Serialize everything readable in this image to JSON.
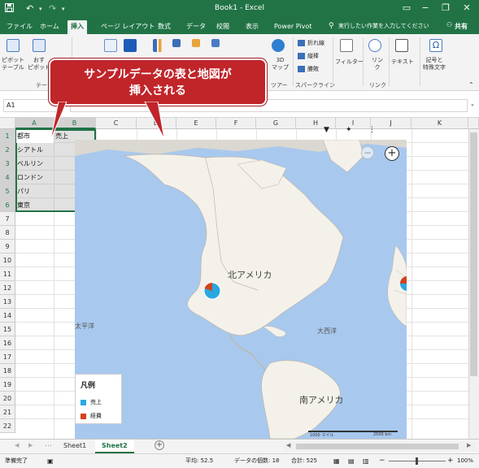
{
  "titlebar": {
    "title": "Book1 - Excel",
    "save_icon": "save-icon",
    "undo_icon": "undo-icon",
    "redo_icon": "redo-icon",
    "minimize": "−",
    "restore": "❐",
    "close": "✕",
    "ribbon_options": "▭"
  },
  "tabs": [
    "ファイル",
    "ホーム",
    "挿入",
    "ページ レイアウト",
    "数式",
    "データ",
    "校閲",
    "表示",
    "Power Pivot"
  ],
  "active_tab": "挿入",
  "tellme": "実行したい作業を入力してください",
  "share": "共有",
  "ribbon": {
    "pivot_label": "ピボット\nテーブル",
    "recommended_pivot_label": "おす\nピボット",
    "table_group": "テー",
    "map3d_label": "3D\nマップ",
    "tour_group": "ツアー",
    "sparklines": [
      "折れ線",
      "縦棒",
      "勝敗"
    ],
    "sparklines_group": "スパークライン",
    "filter_label": "フィルター",
    "link_label": "リン\nク",
    "link_group": "リンク",
    "text_label": "テキスト",
    "symbols_label": "記号と\n特殊文字"
  },
  "namebox": "A1",
  "columns": [
    "A",
    "B",
    "C",
    "D",
    "E",
    "F",
    "G",
    "H",
    "I",
    "J",
    "K"
  ],
  "rows": [
    "1",
    "2",
    "3",
    "4",
    "5",
    "6",
    "7",
    "8",
    "9",
    "10",
    "11",
    "12",
    "13",
    "14",
    "15",
    "16",
    "17",
    "18",
    "19",
    "20",
    "21",
    "22"
  ],
  "cells": {
    "A1": "都市",
    "B1": "売上",
    "A2": "シアトル",
    "A3": "ベルリン",
    "A4": "ロンドン",
    "A5": "パリ",
    "A6": "東京"
  },
  "callout": "サンプルデータの表と地図が\n挿入される",
  "map": {
    "labels": {
      "north_america": "北アメリカ",
      "south_america": "南アメリカ",
      "pacific": "太平洋",
      "atlantic": "大西洋"
    },
    "scale_left": "1000 マイル",
    "scale_right": "2500 km",
    "legend_title": "凡例",
    "legend": [
      {
        "label": "売上",
        "color": "#29a8e0"
      },
      {
        "label": "経費",
        "color": "#d0431f"
      }
    ]
  },
  "sheets": [
    "Sheet1",
    "Sheet2"
  ],
  "active_sheet": "Sheet2",
  "status": {
    "ready": "準備完了",
    "average": "平均: 52.5",
    "count": "データの個数: 18",
    "sum": "合計: 525",
    "zoom": "100%"
  }
}
